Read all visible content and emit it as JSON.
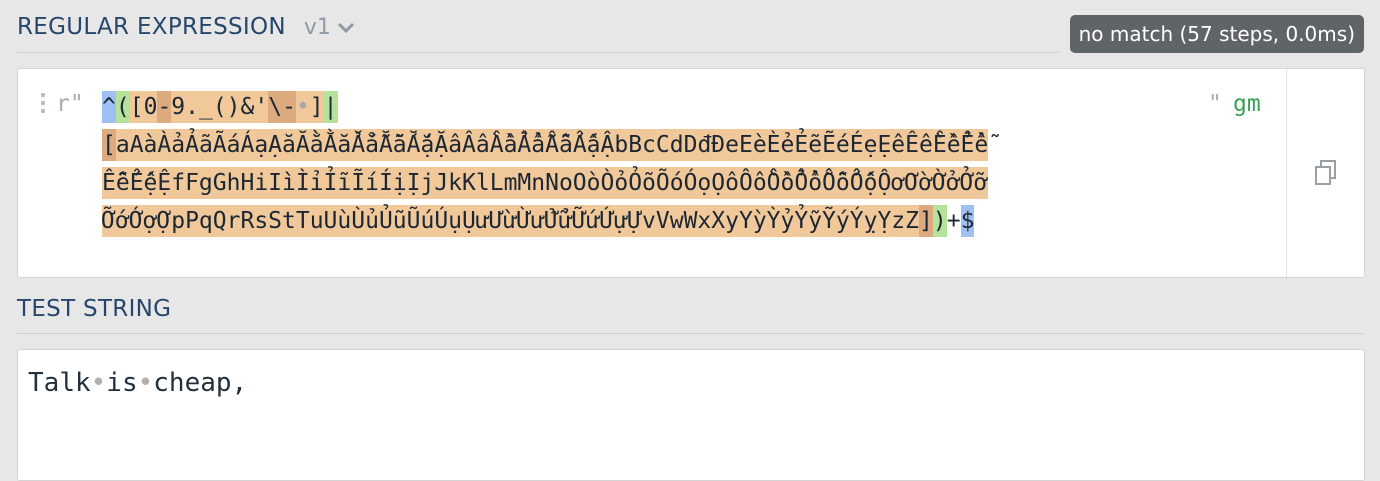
{
  "regex_section": {
    "title": "REGULAR EXPRESSION",
    "version": "v1",
    "status": "no match (57 steps, 0.0ms)",
    "delimiter_open": "r\"",
    "delimiter_close": "\"",
    "flags": "gm",
    "lines": [
      [
        {
          "t": "anchor",
          "s": "^"
        },
        {
          "t": "group",
          "s": "("
        },
        {
          "t": "set",
          "s": "["
        },
        {
          "t": "bg",
          "s": "0"
        },
        {
          "t": "setb",
          "s": "-"
        },
        {
          "t": "bg",
          "s": "9._()&'"
        },
        {
          "t": "setb",
          "s": "\\-"
        },
        {
          "t": "bg",
          "s": " "
        },
        {
          "t": "set",
          "s": "]"
        },
        {
          "t": "alt",
          "s": "|"
        }
      ],
      [
        {
          "t": "setb",
          "s": "["
        },
        {
          "t": "bg",
          "s": "aAàÀảẢãÃáÁạẠăĂằẰẳẲẵẴắẮặẶâÂầẦẩẨẫẪấẤậẬbBcCdDđĐeEèÈẻẺẽẼéÉẹẸêÊềỀểỂễ"
        }
      ],
      [
        {
          "t": "bg",
          "s": "ỄếẾệỆfFgGhHiIìÌỉỈĩĨíÍịỊjJkKlLmMnNoOòÒỏỎõÕóÓọỌôÔồỒổỔỗỖốỐộỘơƠờỜởỞỡ"
        }
      ],
      [
        {
          "t": "bg",
          "s": "ỠớỚợỢpPqQrRsStTuUùÙủỦũŨúÚụỤưƯừỪửỬữỮứỨựỰvVwWxXyYỳỲỷỶỹỸýÝỵỴzZ"
        },
        {
          "t": "setb",
          "s": "]"
        },
        {
          "t": "group",
          "s": ")"
        },
        {
          "t": "plain",
          "s": "+"
        },
        {
          "t": "anchor",
          "s": "$"
        }
      ]
    ]
  },
  "test_section": {
    "title": "TEST STRING",
    "text": "Talk is cheap,"
  },
  "icons": {
    "version_dropdown": "chevron-down-icon",
    "copy": "copy-icon",
    "drag": "drag-handle-icon"
  }
}
